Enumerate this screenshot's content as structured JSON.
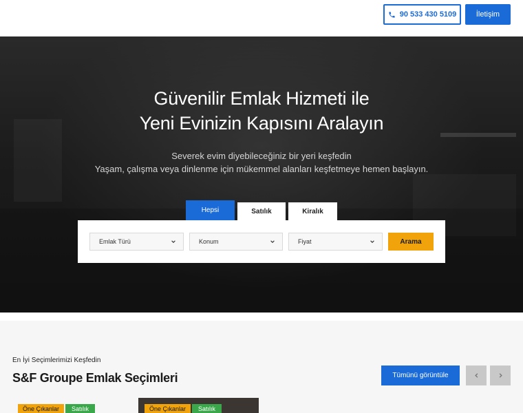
{
  "header": {
    "phone": "90 533 430 5109",
    "contact_label": "İletişim"
  },
  "hero": {
    "title_line1": "Güvenilir Emlak Hizmeti ile",
    "title_line2": "Yeni Evinizin Kapısını Aralayın",
    "subtitle_line1": "Severek evim diyebileceğiniz bir yeri keşfedin",
    "subtitle_line2": "Yaşam, çalışma veya dinlenme için mükemmel alanları keşfetmeye hemen başlayın."
  },
  "search": {
    "tabs": [
      "Hepsi",
      "Satılık",
      "Kiralık"
    ],
    "active_tab": "Hepsi",
    "property_type": "Emlak Türü",
    "location": "Konum",
    "price": "Fiyat",
    "submit_label": "Arama"
  },
  "featured": {
    "eyebrow": "En İyi Seçimlerimizi Keşfedin",
    "title": "S&F Groupe Emlak Seçimleri",
    "view_all_label": "Tümünü görüntüle",
    "cards": [
      {
        "badge_featured": "Öne Çıkanlar",
        "badge_status": "Satılık"
      },
      {
        "badge_featured": "Öne Çıkanlar",
        "badge_status": "Satılık"
      }
    ]
  },
  "colors": {
    "primary": "#1a6bd8",
    "accent": "#f0a30a",
    "success": "#3aa84a"
  },
  "icons": [
    "phone-icon",
    "chevron-down-icon",
    "chevron-left-icon",
    "chevron-right-icon"
  ]
}
